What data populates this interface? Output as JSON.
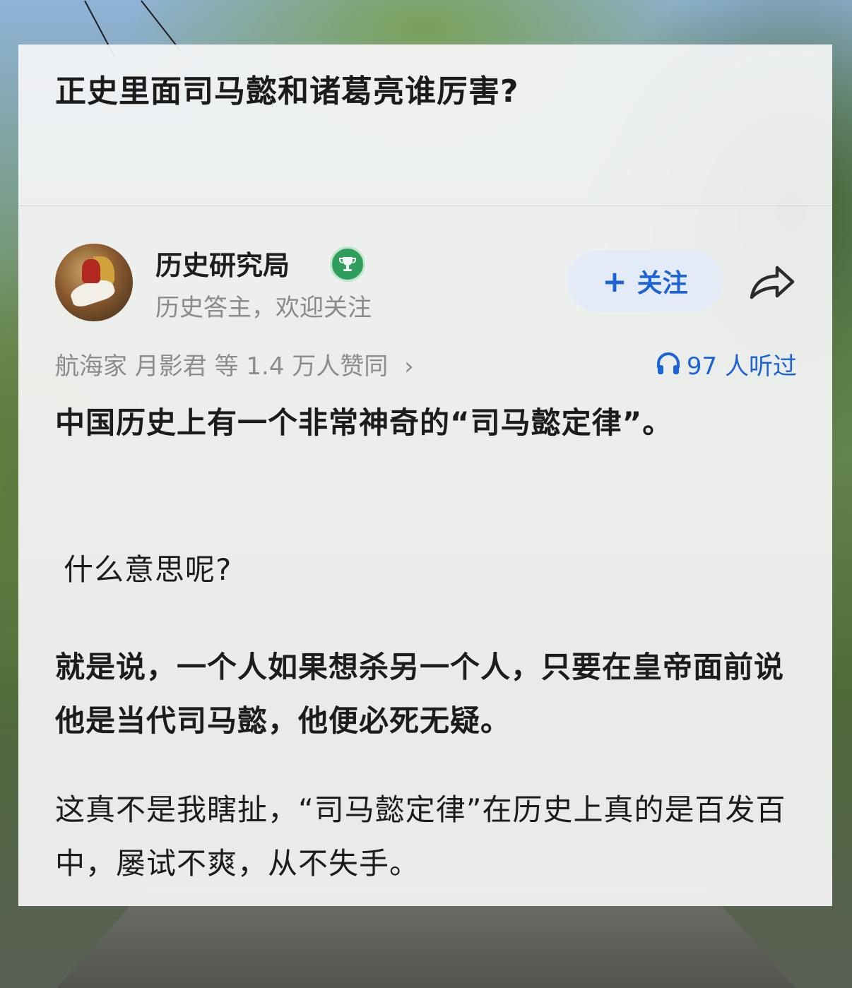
{
  "question": {
    "title": "正史里面司马懿和诸葛亮谁厉害?"
  },
  "author": {
    "name": "历史研究局",
    "description": "历史答主，欢迎关注",
    "badge_icon": "trophy-badge-icon",
    "avatar_icon": "avatar-painting"
  },
  "actions": {
    "follow_plus": "+",
    "follow_label": "关注",
    "share_icon": "share-arrow-icon"
  },
  "stats": {
    "endorse_text": "航海家 月影君 等 1.4 万人赞同",
    "endorse_chevron": "›",
    "listens_text": "97 人听过",
    "listens_icon": "headphones-icon"
  },
  "answer": {
    "paragraphs": [
      "中国历史上有一个非常神奇的“司马懿定律”。",
      "什么意思呢?",
      "就是说，一个人如果想杀另一个人，只要在皇帝面前说他是当代司马懿，他便必死无疑。",
      "这真不是我瞎扯，“司马懿定律”在历史上真的是百发百中，屡试不爽，从不失手。"
    ]
  },
  "colors": {
    "accent_blue": "#1b63d6",
    "follow_bg": "#e3ebf6",
    "badge_green": "#2f9d5c",
    "text_dark": "#1c1c1c",
    "text_gray": "#8a8a8a"
  }
}
